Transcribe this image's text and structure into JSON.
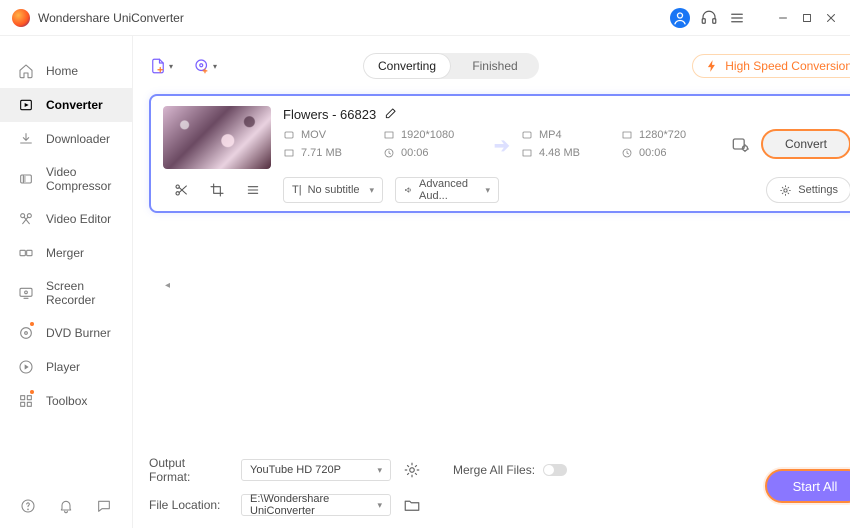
{
  "app": {
    "title": "Wondershare UniConverter"
  },
  "sidebar": {
    "items": [
      {
        "label": "Home"
      },
      {
        "label": "Converter"
      },
      {
        "label": "Downloader"
      },
      {
        "label": "Video Compressor"
      },
      {
        "label": "Video Editor"
      },
      {
        "label": "Merger"
      },
      {
        "label": "Screen Recorder"
      },
      {
        "label": "DVD Burner"
      },
      {
        "label": "Player"
      },
      {
        "label": "Toolbox"
      }
    ]
  },
  "toolbar": {
    "tabs": {
      "converting": "Converting",
      "finished": "Finished"
    },
    "high_speed": "High Speed Conversion"
  },
  "file": {
    "name": "Flowers - 66823",
    "src": {
      "format": "MOV",
      "resolution": "1920*1080",
      "size": "7.71 MB",
      "duration": "00:06"
    },
    "dst": {
      "format": "MP4",
      "resolution": "1280*720",
      "size": "4.48 MB",
      "duration": "00:06"
    },
    "subtitle": "No subtitle",
    "audio": "Advanced Aud...",
    "settings": "Settings",
    "convert": "Convert"
  },
  "footer": {
    "output_format_label": "Output Format:",
    "output_format_value": "YouTube HD 720P",
    "file_location_label": "File Location:",
    "file_location_value": "E:\\Wondershare UniConverter",
    "merge_label": "Merge All Files:",
    "start_all": "Start All"
  }
}
